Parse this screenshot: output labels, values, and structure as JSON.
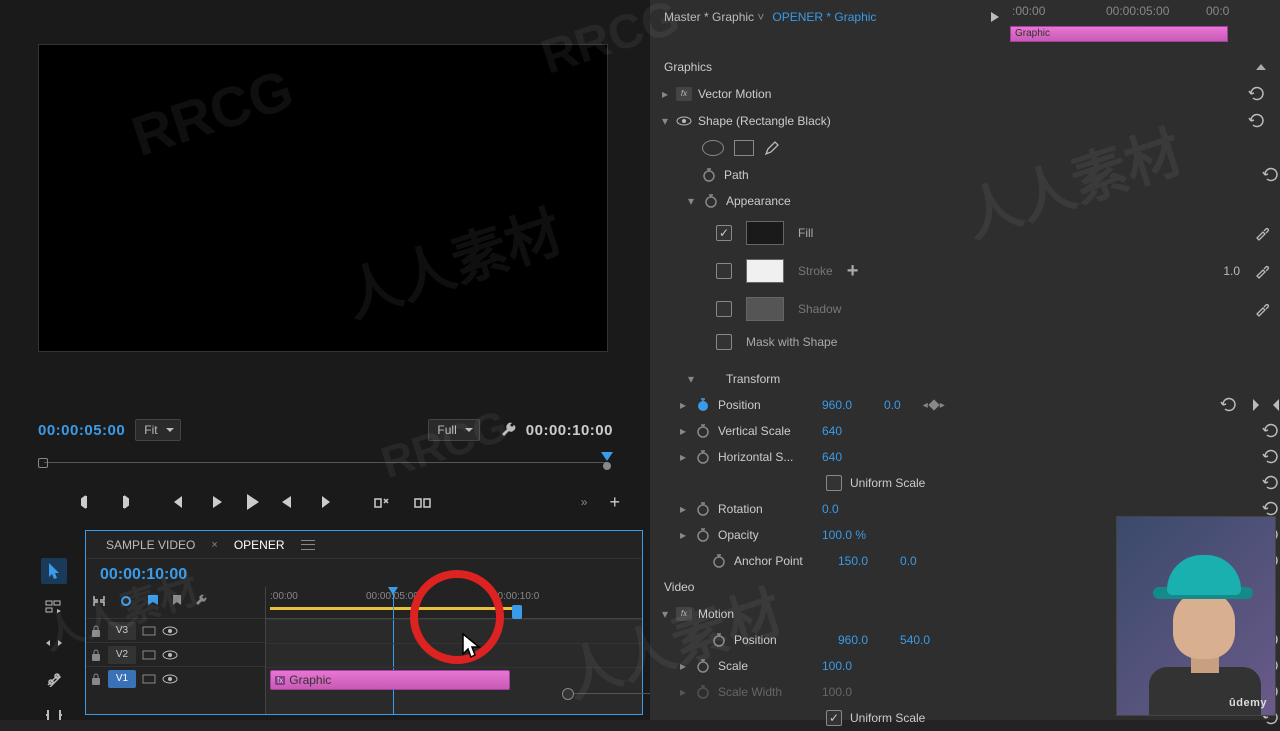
{
  "preview": {
    "timecode_current": "00:00:05:00",
    "timecode_total": "00:00:10:00",
    "fit_select": "Fit",
    "res_select": "Full"
  },
  "timeline": {
    "tab1": "SAMPLE VIDEO",
    "tab2_active": "OPENER",
    "timecode": "00:00:10:00",
    "tracks": {
      "v3": "V3",
      "v2": "V2",
      "v1": "V1"
    },
    "ruler": {
      "t0": ":00:00",
      "t1": "00:00:05:00",
      "t2": "00:00:10:0"
    },
    "clip": {
      "fx": "fx",
      "name": "Graphic"
    }
  },
  "effects_header": {
    "master": "Master * Graphic",
    "opener": "OPENER * Graphic"
  },
  "mini_ruler": {
    "t0": ":00:00",
    "t1": "00:00:05:00",
    "t2": "00:0"
  },
  "mini_clip": "Graphic",
  "sections": {
    "graphics": "Graphics",
    "vector_motion": "Vector Motion",
    "shape": "Shape (Rectangle Black)",
    "path": "Path",
    "appearance": "Appearance",
    "fill": "Fill",
    "stroke": "Stroke",
    "stroke_val": "1.0",
    "shadow": "Shadow",
    "mask_shape": "Mask with Shape",
    "transform": "Transform",
    "position": "Position",
    "position_x": "960.0",
    "position_y": "0.0",
    "vscale": "Vertical Scale",
    "vscale_v": "640",
    "hscale": "Horizontal S...",
    "hscale_v": "640",
    "uniform_scale": "Uniform Scale",
    "rotation": "Rotation",
    "rotation_v": "0.0",
    "opacity": "Opacity",
    "opacity_v": "100.0 %",
    "anchor": "Anchor Point",
    "anchor_x": "150.0",
    "anchor_y": "0.0",
    "video": "Video",
    "motion": "Motion",
    "m_position": "Position",
    "m_position_x": "960.0",
    "m_position_y": "540.0",
    "scale": "Scale",
    "scale_v": "100.0",
    "scale_width": "Scale Width",
    "scale_width_v": "100.0",
    "m_uniform": "Uniform Scale"
  },
  "watermarks": {
    "w1": "RRCG",
    "w2": "人人素材",
    "w3": "RRCG",
    "w4": "人人素材",
    "w5": "RRCG",
    "w6": "人人素材",
    "w7": "人人素材"
  },
  "udemy": "ûdemy"
}
